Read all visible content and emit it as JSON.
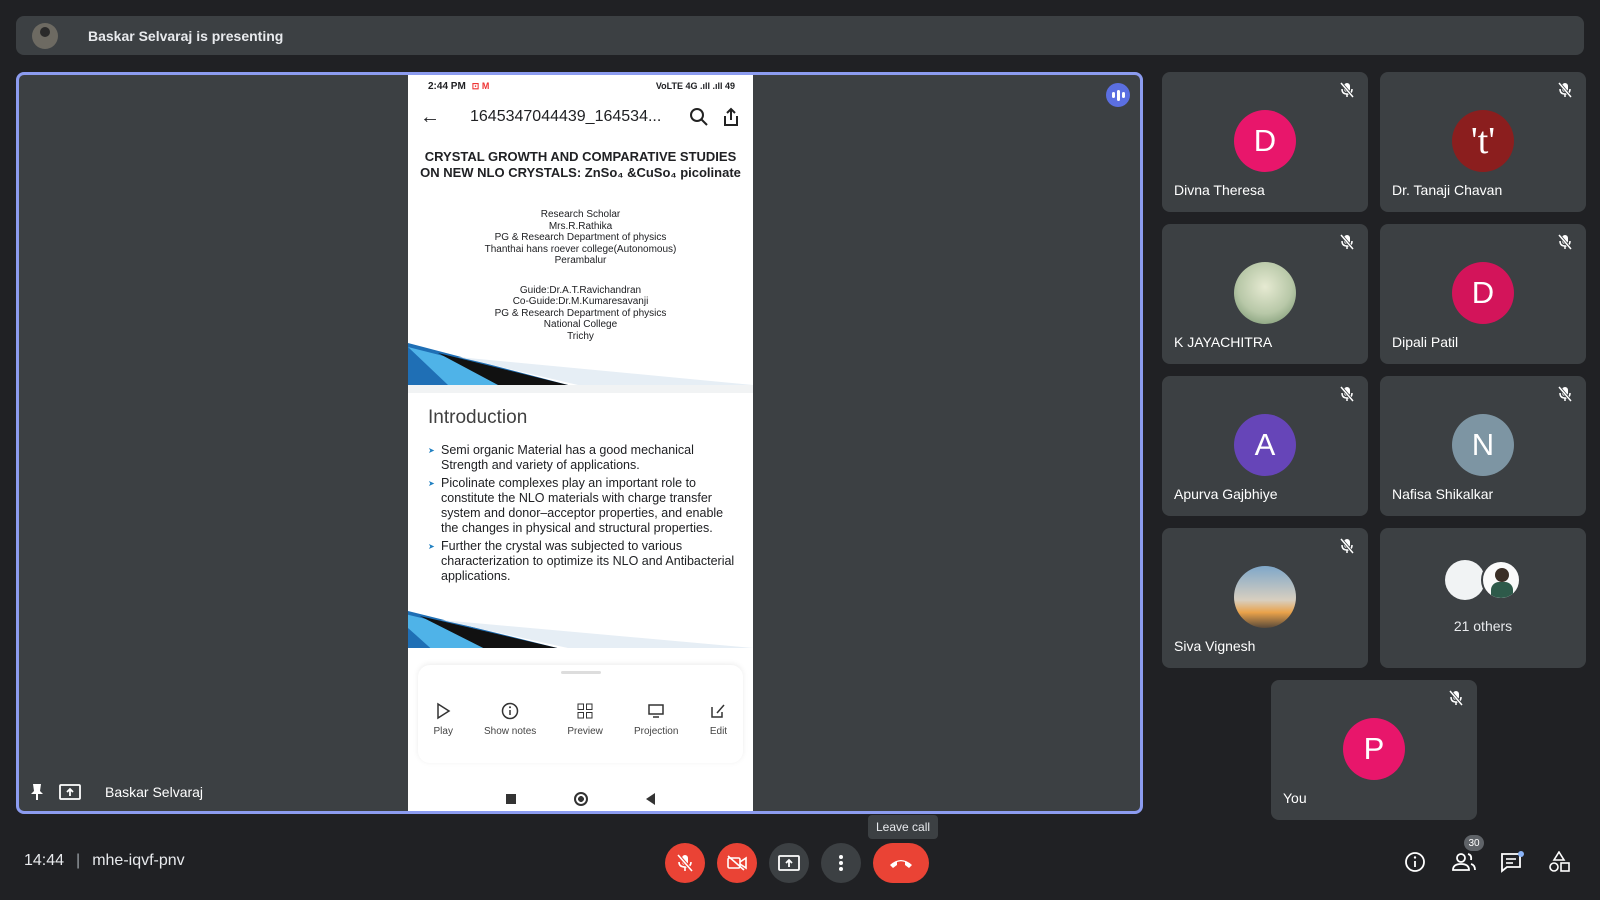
{
  "banner": {
    "presenter_text": "Baskar Selvaraj is presenting"
  },
  "stage": {
    "name": "Baskar Selvaraj"
  },
  "phone": {
    "status_time": "2:44 PM",
    "status_right": "VoLTE 4G .ıll  .ıll  49",
    "file_title": "1645347044439_164534...",
    "slide1": {
      "title_line1": "CRYSTAL GROWTH AND COMPARATIVE STUDIES",
      "title_line2": "ON NEW NLO CRYSTALS: ZnSo₄ &CuSo₄ picolinate",
      "block1": [
        "Research Scholar",
        "Mrs.R.Rathika",
        "PG & Research Department of physics",
        "Thanthai hans roever college(Autonomous)",
        "Perambalur"
      ],
      "block2": [
        "Guide:Dr.A.T.Ravichandran",
        "Co-Guide:Dr.M.Kumaresavanji",
        "PG & Research Department of physics",
        "National College",
        "Trichy"
      ]
    },
    "slide2": {
      "title": "Introduction",
      "bullets": [
        "Semi organic Material has a good mechanical Strength and variety of applications.",
        "Picolinate complexes play an important role to constitute the NLO materials with charge transfer system and donor–acceptor properties, and enable the changes in physical and structural properties.",
        " Further the crystal was subjected to various characterization to optimize its NLO and Antibacterial applications."
      ]
    },
    "tools": [
      {
        "label": "Play",
        "icon": "play-icon"
      },
      {
        "label": "Show notes",
        "icon": "info-icon"
      },
      {
        "label": "Preview",
        "icon": "grid-icon"
      },
      {
        "label": "Projection",
        "icon": "monitor-icon"
      },
      {
        "label": "Edit",
        "icon": "edit-icon"
      }
    ]
  },
  "participants": [
    {
      "name": "Divna Theresa",
      "initial": "D",
      "color": "#e8166b"
    },
    {
      "name": "Dr. Tanaji Chavan",
      "initial": "'t'",
      "color": "#8b1e1e"
    },
    {
      "name": "K JAYACHITRA",
      "initial": "",
      "color": "#9fb8a0"
    },
    {
      "name": "Dipali Patil",
      "initial": "D",
      "color": "#d3145a"
    },
    {
      "name": "Apurva Gajbhiye",
      "initial": "A",
      "color": "#6645b8"
    },
    {
      "name": "Nafisa Shikalkar",
      "initial": "N",
      "color": "#7d95a3"
    },
    {
      "name": "Siva Vignesh",
      "initial": "",
      "color": "#c9c0b3"
    },
    {
      "name": "21 others",
      "initial": "",
      "color": "#3c4043"
    },
    {
      "name": "You",
      "initial": "P",
      "color": "#e8166b"
    }
  ],
  "footer": {
    "time": "14:44",
    "meeting_code": "mhe-iqvf-pnv",
    "leave_tooltip": "Leave call",
    "people_count": "30"
  },
  "colors": {
    "danger": "#ea4335",
    "leave": "#ea4335",
    "tile": "#3c4043",
    "bg": "#202124"
  }
}
